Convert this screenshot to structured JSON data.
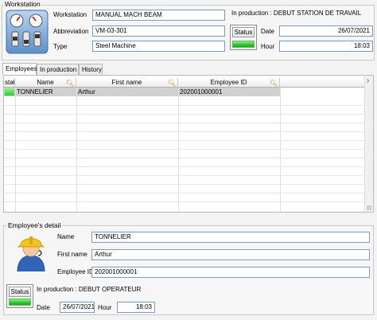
{
  "workstation": {
    "section_title": "Workstation",
    "workstation_label": "Workstation",
    "workstation_value": "MANUAL MACH BEAM",
    "in_production": "In production : DEBUT STATION DE TRAVAIL",
    "abbreviation_label": "Abbreviation",
    "abbreviation_value": "VM-03-301",
    "type_label": "Type",
    "type_value": "Steel Machine",
    "status_label": "Status",
    "status_color": "#32c832",
    "date_label": "Date",
    "date_value": "26/07/2021",
    "hour_label": "Hour",
    "hour_value": "18:03"
  },
  "tabs": [
    {
      "label": "Employees",
      "active": true
    },
    {
      "label": "In production",
      "active": false
    },
    {
      "label": "History",
      "active": false
    }
  ],
  "table": {
    "columns": [
      "Status",
      "Name",
      "First name",
      "Employee ID"
    ],
    "col0_visible": "statu",
    "rows": [
      {
        "status_color": "#32c832",
        "name": "TONNELIER",
        "first_name": "Arthur",
        "employee_id": "202001000001"
      }
    ],
    "scroll_arrow": "›"
  },
  "employee_detail": {
    "section_title": "Employee's detail",
    "name_label": "Name",
    "name_value": "TONNELIER",
    "first_name_label": "First name",
    "first_name_value": "Arthur",
    "employee_id_label": "Employee ID",
    "employee_id_value": "202001000001",
    "status_label": "Status",
    "status_color": "#32c832",
    "in_production": "In production : DEBUT OPERATEUR",
    "date_label": "Date",
    "date_value": "26/07/2021",
    "hour_label": "Hour",
    "hour_value": "18:03"
  },
  "icons": {
    "workstation": "control-panel-icon",
    "employee": "worker-hardhat-icon",
    "search": "magnifier-icon"
  }
}
